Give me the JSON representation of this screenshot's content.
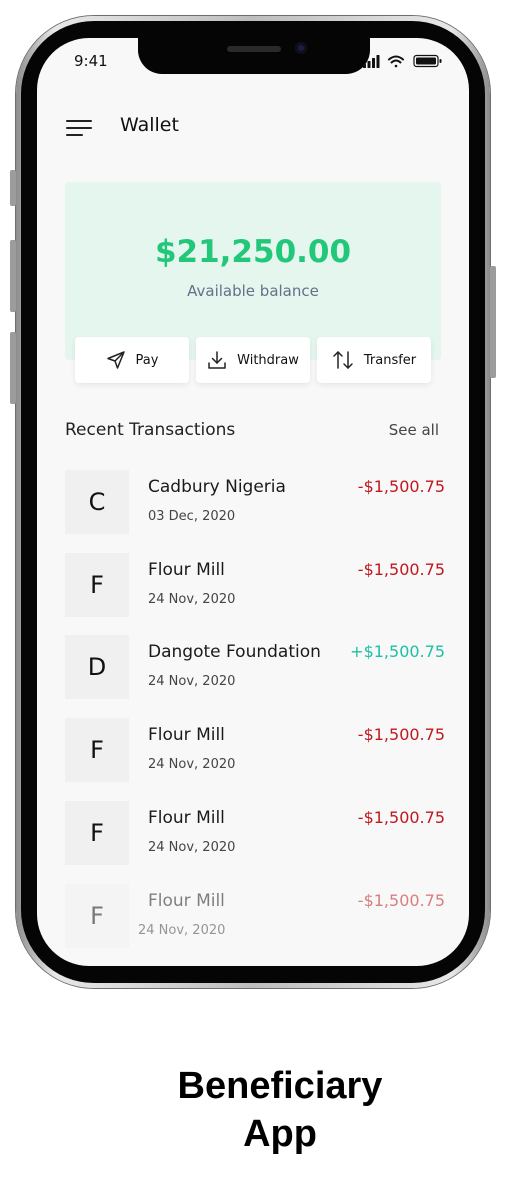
{
  "status_bar": {
    "time": "9:41"
  },
  "header": {
    "title": "Wallet",
    "menu_icon": "hamburger-icon"
  },
  "balance": {
    "amount": "$21,250.00",
    "label": "Available balance"
  },
  "actions": [
    {
      "label": "Pay",
      "icon": "send-icon"
    },
    {
      "label": "Withdraw",
      "icon": "download-icon"
    },
    {
      "label": "Transfer",
      "icon": "transfer-arrows-icon"
    }
  ],
  "recent": {
    "title": "Recent Transactions",
    "see_all": "See all"
  },
  "transactions": [
    {
      "initial": "C",
      "name": "Cadbury Nigeria",
      "date": "03 Dec, 2020",
      "amount": "-$1,500.75",
      "type": "debit"
    },
    {
      "initial": "F",
      "name": "Flour Mill",
      "date": "24 Nov, 2020",
      "amount": "-$1,500.75",
      "type": "debit"
    },
    {
      "initial": "D",
      "name": "Dangote Foundation",
      "date": "24 Nov, 2020",
      "amount": "+$1,500.75",
      "type": "credit"
    },
    {
      "initial": "F",
      "name": "Flour Mill",
      "date": "24 Nov, 2020",
      "amount": "-$1,500.75",
      "type": "debit"
    },
    {
      "initial": "F",
      "name": "Flour Mill",
      "date": "24 Nov, 2020",
      "amount": "-$1,500.75",
      "type": "debit"
    },
    {
      "initial": "F",
      "name": "Flour Mill",
      "date": "24 Nov, 2020",
      "amount": "-$1,500.75",
      "type": "debit"
    }
  ],
  "colors": {
    "accent": "#22c77a",
    "debit": "#c0181f",
    "credit": "#1dbfa6",
    "card_bg": "#e4f6ee"
  },
  "caption": {
    "line1": "Beneficiary",
    "line2": "App"
  }
}
